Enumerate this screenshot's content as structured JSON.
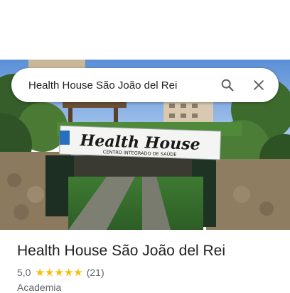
{
  "search": {
    "query": "Health House São João del Rei",
    "search_icon": "search-icon",
    "clear_icon": "close-icon"
  },
  "photo": {
    "sign_title": "Health House",
    "sign_subtitle": "CENTRO INTEGRADO DE SAÚDE"
  },
  "place": {
    "name": "Health House São João del Rei",
    "rating": "5,0",
    "stars": 5,
    "review_count": "(21)",
    "category": "Academia"
  },
  "colors": {
    "star": "#fbbc04",
    "title": "#202124",
    "secondary": "#5f6368"
  }
}
